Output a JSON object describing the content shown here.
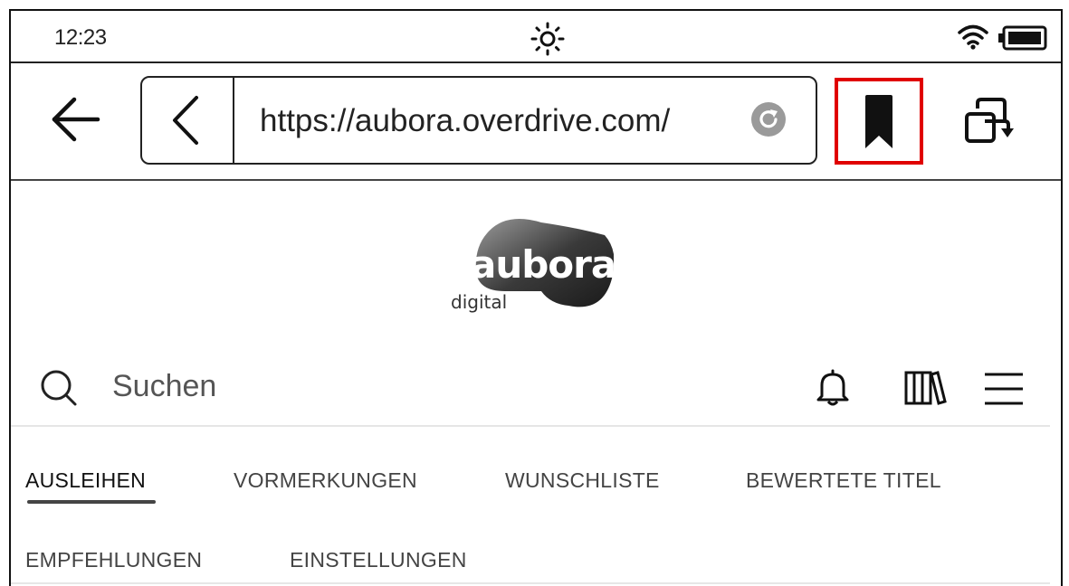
{
  "status_bar": {
    "time": "12:23",
    "icons": [
      "brightness-icon",
      "wifi-icon",
      "battery-icon"
    ]
  },
  "browser_bar": {
    "url": "https://aubora.overdrive.com/",
    "icons": [
      "back-arrow-icon",
      "url-back-chevron-icon",
      "reload-icon",
      "bookmark-icon",
      "rotate-screen-icon"
    ],
    "highlight_color": "#e00000"
  },
  "logo": {
    "word": "aubora",
    "sub": "digital"
  },
  "search": {
    "placeholder": "Suchen"
  },
  "header_icons": [
    "search-icon",
    "bell-icon",
    "library-icon",
    "menu-icon"
  ],
  "nav": {
    "tabs": [
      {
        "label": "AUSLEIHEN",
        "active": true
      },
      {
        "label": "VORMERKUNGEN",
        "active": false
      },
      {
        "label": "WUNSCHLISTE",
        "active": false
      },
      {
        "label": "BEWERTETE TITEL",
        "active": false
      },
      {
        "label": "EMPFEHLUNGEN",
        "active": false
      },
      {
        "label": "EINSTELLUNGEN",
        "active": false
      }
    ]
  }
}
